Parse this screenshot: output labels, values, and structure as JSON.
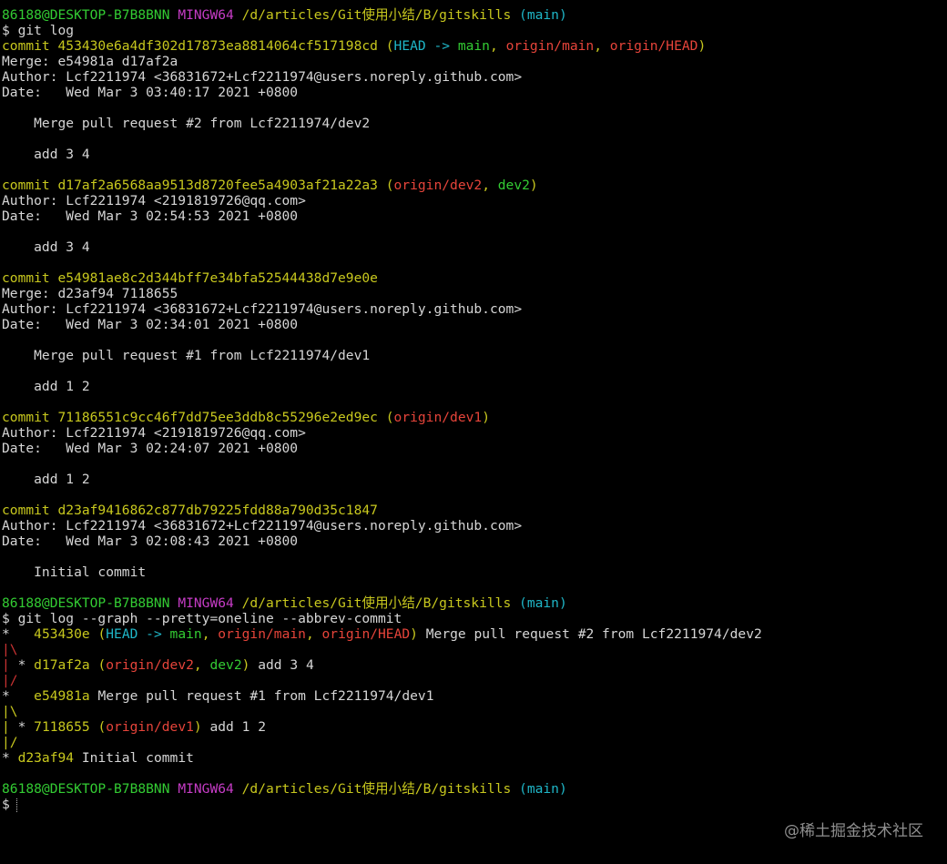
{
  "colors": {
    "background": "#000000",
    "default_text": "#d6d6d6",
    "user_host": "#33cc33",
    "env": "#c63cc6",
    "path_and_commit": "#c8c81e",
    "branch_head": "#1fb7c8",
    "remote_branch": "#e6443a",
    "local_branch": "#33cc33",
    "graph_line": "#cc3333"
  },
  "terminal": {
    "lines": [
      [
        {
          "t": "86188@DESKTOP-B7B8BNN",
          "c": "green"
        },
        {
          "t": " "
        },
        {
          "t": "MINGW64",
          "c": "purple"
        },
        {
          "t": " "
        },
        {
          "t": "/d/articles/Git使用小结/B/gitskills",
          "c": "yellow"
        },
        {
          "t": " "
        },
        {
          "t": "(main)",
          "c": "cyan"
        }
      ],
      [
        {
          "t": "$ git log"
        }
      ],
      [
        {
          "t": "commit 453430e6a4df302d17873ea8814064cf517198cd",
          "c": "yellow"
        },
        {
          "t": " (",
          "c": "yellow"
        },
        {
          "t": "HEAD -> ",
          "c": "cyan"
        },
        {
          "t": "main",
          "c": "green"
        },
        {
          "t": ", ",
          "c": "yellow"
        },
        {
          "t": "origin/main",
          "c": "red"
        },
        {
          "t": ", ",
          "c": "yellow"
        },
        {
          "t": "origin/HEAD",
          "c": "red"
        },
        {
          "t": ")",
          "c": "yellow"
        }
      ],
      [
        {
          "t": "Merge: e54981a d17af2a"
        }
      ],
      [
        {
          "t": "Author: Lcf2211974 <36831672+Lcf2211974@users.noreply.github.com>"
        }
      ],
      [
        {
          "t": "Date:   Wed Mar 3 03:40:17 2021 +0800"
        }
      ],
      [],
      [
        {
          "t": "    Merge pull request #2 from Lcf2211974/dev2"
        }
      ],
      [],
      [
        {
          "t": "    add 3 4"
        }
      ],
      [],
      [
        {
          "t": "commit d17af2a6568aa9513d8720fee5a4903af21a22a3",
          "c": "yellow"
        },
        {
          "t": " (",
          "c": "yellow"
        },
        {
          "t": "origin/dev2",
          "c": "red"
        },
        {
          "t": ", ",
          "c": "yellow"
        },
        {
          "t": "dev2",
          "c": "green"
        },
        {
          "t": ")",
          "c": "yellow"
        }
      ],
      [
        {
          "t": "Author: Lcf2211974 <2191819726@qq.com>"
        }
      ],
      [
        {
          "t": "Date:   Wed Mar 3 02:54:53 2021 +0800"
        }
      ],
      [],
      [
        {
          "t": "    add 3 4"
        }
      ],
      [],
      [
        {
          "t": "commit e54981ae8c2d344bff7e34bfa52544438d7e9e0e",
          "c": "yellow"
        }
      ],
      [
        {
          "t": "Merge: d23af94 7118655"
        }
      ],
      [
        {
          "t": "Author: Lcf2211974 <36831672+Lcf2211974@users.noreply.github.com>"
        }
      ],
      [
        {
          "t": "Date:   Wed Mar 3 02:34:01 2021 +0800"
        }
      ],
      [],
      [
        {
          "t": "    Merge pull request #1 from Lcf2211974/dev1"
        }
      ],
      [],
      [
        {
          "t": "    add 1 2"
        }
      ],
      [],
      [
        {
          "t": "commit 71186551c9cc46f7dd75ee3ddb8c55296e2ed9ec",
          "c": "yellow"
        },
        {
          "t": " (",
          "c": "yellow"
        },
        {
          "t": "origin/dev1",
          "c": "red"
        },
        {
          "t": ")",
          "c": "yellow"
        }
      ],
      [
        {
          "t": "Author: Lcf2211974 <2191819726@qq.com>"
        }
      ],
      [
        {
          "t": "Date:   Wed Mar 3 02:24:07 2021 +0800"
        }
      ],
      [],
      [
        {
          "t": "    add 1 2"
        }
      ],
      [],
      [
        {
          "t": "commit d23af9416862c877db79225fdd88a790d35c1847",
          "c": "yellow"
        }
      ],
      [
        {
          "t": "Author: Lcf2211974 <36831672+Lcf2211974@users.noreply.github.com>"
        }
      ],
      [
        {
          "t": "Date:   Wed Mar 3 02:08:43 2021 +0800"
        }
      ],
      [],
      [
        {
          "t": "    Initial commit"
        }
      ],
      [],
      [
        {
          "t": "86188@DESKTOP-B7B8BNN",
          "c": "green"
        },
        {
          "t": " "
        },
        {
          "t": "MINGW64",
          "c": "purple"
        },
        {
          "t": " "
        },
        {
          "t": "/d/articles/Git使用小结/B/gitskills",
          "c": "yellow"
        },
        {
          "t": " "
        },
        {
          "t": "(main)",
          "c": "cyan"
        }
      ],
      [
        {
          "t": "$ git log --graph --pretty=oneline --abbrev-commit"
        }
      ],
      [
        {
          "t": "*   "
        },
        {
          "t": "453430e",
          "c": "yellow"
        },
        {
          "t": " (",
          "c": "yellow"
        },
        {
          "t": "HEAD -> ",
          "c": "cyan"
        },
        {
          "t": "main",
          "c": "green"
        },
        {
          "t": ", ",
          "c": "yellow"
        },
        {
          "t": "origin/main",
          "c": "red"
        },
        {
          "t": ", ",
          "c": "yellow"
        },
        {
          "t": "origin/HEAD",
          "c": "red"
        },
        {
          "t": ")",
          "c": "yellow"
        },
        {
          "t": " Merge pull request #2 from Lcf2211974/dev2"
        }
      ],
      [
        {
          "t": "|",
          "c": "graph"
        },
        {
          "t": "\\",
          "c": "graph"
        }
      ],
      [
        {
          "t": "|",
          "c": "graph"
        },
        {
          "t": " * "
        },
        {
          "t": "d17af2a",
          "c": "yellow"
        },
        {
          "t": " (",
          "c": "yellow"
        },
        {
          "t": "origin/dev2",
          "c": "red"
        },
        {
          "t": ", ",
          "c": "yellow"
        },
        {
          "t": "dev2",
          "c": "green"
        },
        {
          "t": ")",
          "c": "yellow"
        },
        {
          "t": " add 3 4"
        }
      ],
      [
        {
          "t": "|/",
          "c": "graph"
        }
      ],
      [
        {
          "t": "*   "
        },
        {
          "t": "e54981a",
          "c": "yellow"
        },
        {
          "t": " Merge pull request #1 from Lcf2211974/dev1"
        }
      ],
      [
        {
          "t": "|",
          "c": "yellow"
        },
        {
          "t": "\\",
          "c": "yellow"
        }
      ],
      [
        {
          "t": "|",
          "c": "yellow"
        },
        {
          "t": " * "
        },
        {
          "t": "7118655",
          "c": "yellow"
        },
        {
          "t": " (",
          "c": "yellow"
        },
        {
          "t": "origin/dev1",
          "c": "red"
        },
        {
          "t": ")",
          "c": "yellow"
        },
        {
          "t": " add 1 2"
        }
      ],
      [
        {
          "t": "|/",
          "c": "yellow"
        }
      ],
      [
        {
          "t": "* "
        },
        {
          "t": "d23af94",
          "c": "yellow"
        },
        {
          "t": " Initial commit"
        }
      ],
      [],
      [
        {
          "t": "86188@DESKTOP-B7B8BNN",
          "c": "green"
        },
        {
          "t": " "
        },
        {
          "t": "MINGW64",
          "c": "purple"
        },
        {
          "t": " "
        },
        {
          "t": "/d/articles/Git使用小结/B/gitskills",
          "c": "yellow"
        },
        {
          "t": " "
        },
        {
          "t": "(main)",
          "c": "cyan"
        }
      ],
      [
        {
          "t": "$",
          "cursor": true
        }
      ]
    ]
  },
  "watermark": "@稀土掘金技术社区"
}
